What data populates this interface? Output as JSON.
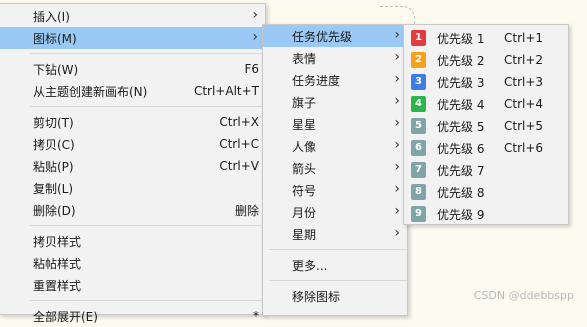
{
  "menu_main": {
    "items": [
      {
        "label": "插入(I)",
        "shortcut": "",
        "submenu": true
      },
      {
        "label": "图标(M)",
        "shortcut": "",
        "submenu": true,
        "highlighted": true
      },
      {
        "label": "下钻(W)",
        "shortcut": "F6",
        "submenu": false
      },
      {
        "label": "从主题创建新画布(N)",
        "shortcut": "Ctrl+Alt+T",
        "submenu": false
      },
      {
        "label": "剪切(T)",
        "shortcut": "Ctrl+X",
        "submenu": false
      },
      {
        "label": "拷贝(C)",
        "shortcut": "Ctrl+C",
        "submenu": false
      },
      {
        "label": "粘贴(P)",
        "shortcut": "Ctrl+V",
        "submenu": false
      },
      {
        "label": "复制(L)",
        "shortcut": "",
        "submenu": false
      },
      {
        "label": "删除(D)",
        "shortcut": "删除",
        "submenu": false
      },
      {
        "label": "拷贝样式",
        "shortcut": "",
        "submenu": false
      },
      {
        "label": "粘帖样式",
        "shortcut": "",
        "submenu": false
      },
      {
        "label": "重置样式",
        "shortcut": "",
        "submenu": false
      },
      {
        "label": "全部展开(E)",
        "shortcut": "*",
        "submenu": false
      }
    ]
  },
  "menu_icons": {
    "items": [
      {
        "label": "任务优先级",
        "highlighted": true
      },
      {
        "label": "表情"
      },
      {
        "label": "任务进度"
      },
      {
        "label": "旗子"
      },
      {
        "label": "星星"
      },
      {
        "label": "人像"
      },
      {
        "label": "箭头"
      },
      {
        "label": "符号"
      },
      {
        "label": "月份"
      },
      {
        "label": "星期"
      },
      {
        "label": "更多..."
      },
      {
        "label": "移除图标"
      }
    ]
  },
  "menu_priority": {
    "items": [
      {
        "label": "优先级 1",
        "shortcut": "Ctrl+1",
        "num": "1",
        "color": "#e23c3c"
      },
      {
        "label": "优先级 2",
        "shortcut": "Ctrl+2",
        "num": "2",
        "color": "#f4a21e"
      },
      {
        "label": "优先级 3",
        "shortcut": "Ctrl+3",
        "num": "3",
        "color": "#3d7ee6"
      },
      {
        "label": "优先级 4",
        "shortcut": "Ctrl+4",
        "num": "4",
        "color": "#2cb34a"
      },
      {
        "label": "优先级 5",
        "shortcut": "Ctrl+5",
        "num": "5",
        "color": "#7fa5a8"
      },
      {
        "label": "优先级 6",
        "shortcut": "Ctrl+6",
        "num": "6",
        "color": "#7fa5a8"
      },
      {
        "label": "优先级 7",
        "shortcut": "",
        "num": "7",
        "color": "#7fa5a8"
      },
      {
        "label": "优先级 8",
        "shortcut": "",
        "num": "8",
        "color": "#7fa5a8"
      },
      {
        "label": "优先级 9",
        "shortcut": "",
        "num": "9",
        "color": "#7fa5a8"
      }
    ]
  },
  "watermark": "CSDN @ddebbspp",
  "submenu_arrow": "›"
}
